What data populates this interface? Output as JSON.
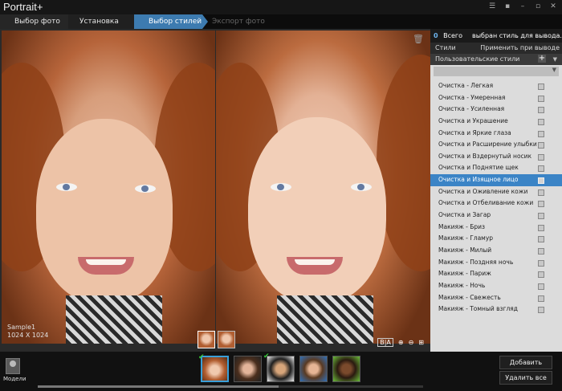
{
  "app": {
    "title": "Portrait+"
  },
  "steps": [
    {
      "label": "Выбор фото"
    },
    {
      "label": "Установка точек"
    },
    {
      "label": "Выбор стилей"
    },
    {
      "label": "Экспорт фото"
    }
  ],
  "photo": {
    "name": "Sample1",
    "size": "1024 X 1024"
  },
  "view_controls": {
    "ba": "B|A"
  },
  "sidebar": {
    "count": "0",
    "count_label": "Всего",
    "message": "выбран стиль для вывода.",
    "styles_label": "Стили",
    "apply_label": "Применить при выводе",
    "group_label": "Пользовательские стили",
    "items": [
      {
        "label": "Очистка - Легкая"
      },
      {
        "label": "Очистка - Умеренная"
      },
      {
        "label": "Очистка - Усиленная"
      },
      {
        "label": "Очистка и Украшение"
      },
      {
        "label": "Очистка и Яркие глаза"
      },
      {
        "label": "Очистка и Расширение улыбки"
      },
      {
        "label": "Очистка и Вздернутый носик"
      },
      {
        "label": "Очистка и Поднятие щек"
      },
      {
        "label": "Очистка и Изящное лицо"
      },
      {
        "label": "Очистка и Оживление кожи"
      },
      {
        "label": "Очистка и Отбеливание кожи"
      },
      {
        "label": "Очистка и Загар"
      },
      {
        "label": "Макияж - Бриз"
      },
      {
        "label": "Макияж - Гламур"
      },
      {
        "label": "Макияж - Милый"
      },
      {
        "label": "Макияж - Поздняя ночь"
      },
      {
        "label": "Макияж - Париж"
      },
      {
        "label": "Макияж - Ночь"
      },
      {
        "label": "Макияж - Свежесть"
      },
      {
        "label": "Макияж - Томный взгляд"
      }
    ],
    "selected_index": 8
  },
  "footer": {
    "models_label": "Модели",
    "add_photo": "Добавить фото",
    "delete_all": "Удалить все"
  },
  "colors": {
    "accent": "#3b84c6",
    "step_active": "#3d7bb0"
  }
}
